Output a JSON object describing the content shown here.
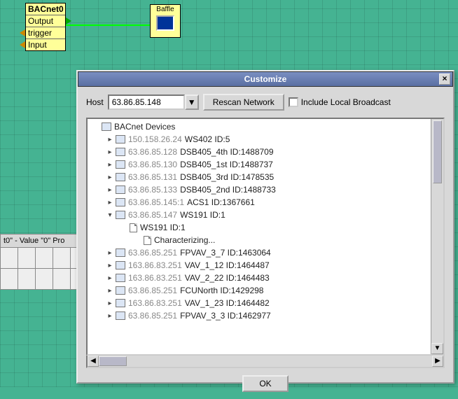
{
  "canvas": {
    "nodeA": {
      "title": "BACnet0",
      "rows": [
        "Output",
        "trigger",
        "Input"
      ]
    },
    "nodeB": {
      "title": "Baffle"
    }
  },
  "sidefrag": {
    "label": "t0\" - Value \"0\" Pro"
  },
  "dialog": {
    "title": "Customize",
    "host_label": "Host",
    "host_value": "63.86.85.148",
    "rescan_label": "Rescan Network",
    "include_label": "Include Local Broadcast",
    "ok_label": "OK",
    "tree": [
      {
        "depth": 0,
        "exp": "none",
        "icon": "folder",
        "addr": "",
        "label": "BACnet Devices"
      },
      {
        "depth": 1,
        "exp": "closed",
        "icon": "folder",
        "addr": "150.158.26.24",
        "label": "WS402 ID:5"
      },
      {
        "depth": 1,
        "exp": "closed",
        "icon": "folder",
        "addr": "63.86.85.128",
        "label": "DSB405_4th ID:1488709"
      },
      {
        "depth": 1,
        "exp": "closed",
        "icon": "folder",
        "addr": "63.86.85.130",
        "label": "DSB405_1st ID:1488737"
      },
      {
        "depth": 1,
        "exp": "closed",
        "icon": "folder",
        "addr": "63.86.85.131",
        "label": "DSB405_3rd ID:1478535"
      },
      {
        "depth": 1,
        "exp": "closed",
        "icon": "folder",
        "addr": "63.86.85.133",
        "label": "DSB405_2nd ID:1488733"
      },
      {
        "depth": 1,
        "exp": "closed",
        "icon": "folder",
        "addr": "63.86.85.145:1",
        "label": "ACS1 ID:1367661"
      },
      {
        "depth": 1,
        "exp": "open",
        "icon": "folder",
        "addr": "63.86.85.147",
        "label": "WS191 ID:1"
      },
      {
        "depth": 2,
        "exp": "leaf",
        "icon": "doc",
        "addr": "",
        "label": "WS191 ID:1"
      },
      {
        "depth": 3,
        "exp": "leaf",
        "icon": "doc",
        "addr": "",
        "label": "Characterizing..."
      },
      {
        "depth": 1,
        "exp": "closed",
        "icon": "folder",
        "addr": "63.86.85.251",
        "label": "FPVAV_3_7 ID:1463064"
      },
      {
        "depth": 1,
        "exp": "closed",
        "icon": "folder",
        "addr": "163.86.83.251",
        "label": "VAV_1_12 ID:1464487"
      },
      {
        "depth": 1,
        "exp": "closed",
        "icon": "folder",
        "addr": "163.86.83.251",
        "label": "VAV_2_22 ID:1464483"
      },
      {
        "depth": 1,
        "exp": "closed",
        "icon": "folder",
        "addr": "63.86.85.251",
        "label": "FCUNorth ID:1429298"
      },
      {
        "depth": 1,
        "exp": "closed",
        "icon": "folder",
        "addr": "163.86.83.251",
        "label": "VAV_1_23 ID:1464482"
      },
      {
        "depth": 1,
        "exp": "closed",
        "icon": "folder",
        "addr": "63.86.85.251",
        "label": "FPVAV_3_3 ID:1462977"
      }
    ]
  }
}
